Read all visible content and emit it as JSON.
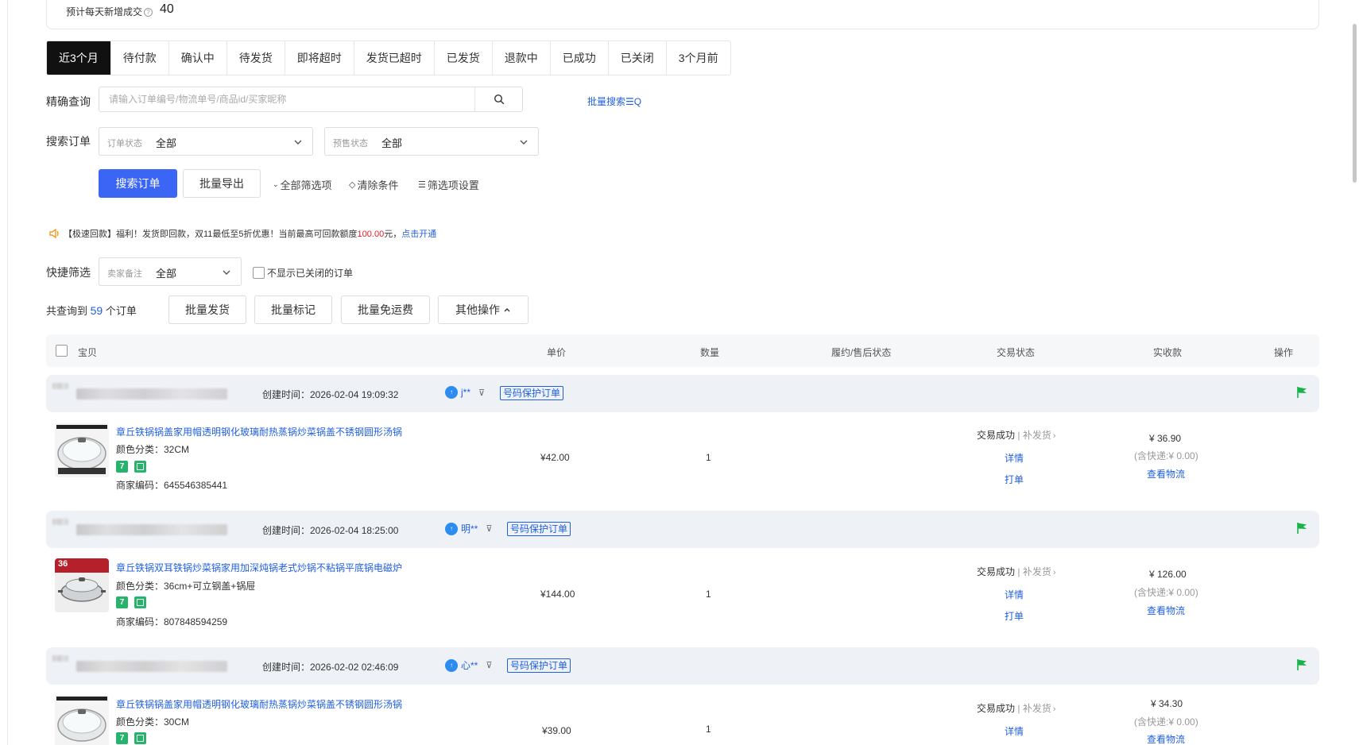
{
  "summary": {
    "label": "预计每天新增成交",
    "value": "40"
  },
  "tabs": [
    "近3个月",
    "待付款",
    "确认中",
    "待发货",
    "即将超时",
    "发货已超时",
    "已发货",
    "退款中",
    "已成功",
    "已关闭",
    "3个月前"
  ],
  "precise": {
    "label": "精确查询",
    "placeholder": "请输入订单编号/物流单号/商品id/买家昵称",
    "batch_search": "批量搜索"
  },
  "search_orders": {
    "label": "搜索订单",
    "order_status": {
      "label": "订单状态",
      "value": "全部"
    },
    "presale_status": {
      "label": "预售状态",
      "value": "全部"
    }
  },
  "actions": {
    "search": "搜索订单",
    "export": "批量导出",
    "all_filters": "全部筛选项",
    "clear": "清除条件",
    "settings": "筛选项设置"
  },
  "notice": {
    "prefix": "【极速回款】福利！发货即回款，双11最低至5折优惠！当前最高可回款额度",
    "amount": "100.00",
    "suffix": "元，",
    "link": "点击开通"
  },
  "quick": {
    "label": "快捷筛选",
    "memo_label": "卖家备注",
    "memo_value": "全部",
    "hide_closed": "不显示已关闭的订单"
  },
  "total": {
    "prefix": "共查询到",
    "count": "59",
    "suffix": "个订单"
  },
  "bulk": {
    "ship": "批量发货",
    "mark": "批量标记",
    "free_ship": "批量免运费",
    "other": "其他操作"
  },
  "columns": [
    "宝贝",
    "单价",
    "数量",
    "履约/售后状态",
    "交易状态",
    "实收款",
    "操作"
  ],
  "orders": [
    {
      "created": "创建时间：2026-02-04 19:09:32",
      "buyer": "j**",
      "protect": "号码保护订单",
      "title": "章丘铁锅锅盖家用帽透明钢化玻璃耐热蒸锅炒菜锅盖不锈钢圆形汤锅",
      "sku": "颜色分类：32CM",
      "code": "商家编码：645546385441",
      "price": "¥42.00",
      "qty": "1",
      "status": "交易成功",
      "status_sub": "补发货",
      "detail": "详情",
      "print": "打单",
      "amount": "¥ 36.90",
      "ship_fee": "(含快递:¥ 0.00)",
      "logistics": "查看物流"
    },
    {
      "created": "创建时间：2026-02-04 18:25:00",
      "buyer": "明**",
      "protect": "号码保护订单",
      "title": "章丘铁锅双耳铁锅炒菜锅家用加深炖锅老式炒锅不粘锅平底锅电磁炉",
      "sku": "颜色分类：36cm+可立钢盖+锅屉",
      "code": "商家编码：807848594259",
      "price": "¥144.00",
      "qty": "1",
      "status": "交易成功",
      "status_sub": "补发货",
      "detail": "详情",
      "print": "打单",
      "amount": "¥ 126.00",
      "ship_fee": "(含快递:¥ 0.00)",
      "logistics": "查看物流",
      "img_badge": "36"
    },
    {
      "created": "创建时间：2026-02-02 02:46:09",
      "buyer": "心**",
      "protect": "号码保护订单",
      "title": "章丘铁锅锅盖家用帽透明钢化玻璃耐热蒸锅炒菜锅盖不锈钢圆形汤锅",
      "sku": "颜色分类：30CM",
      "price": "¥39.00",
      "qty": "1",
      "status": "交易成功",
      "status_sub": "补发货",
      "detail": "详情",
      "amount": "¥ 34.30",
      "ship_fee": "(含快递:¥ 0.00)",
      "logistics": "查看物流"
    }
  ],
  "colors": {
    "primary": "#3b66f5",
    "link": "#1f5fe0",
    "flag": "#18b34a",
    "tag": "#27b36b",
    "danger": "#e02020"
  }
}
